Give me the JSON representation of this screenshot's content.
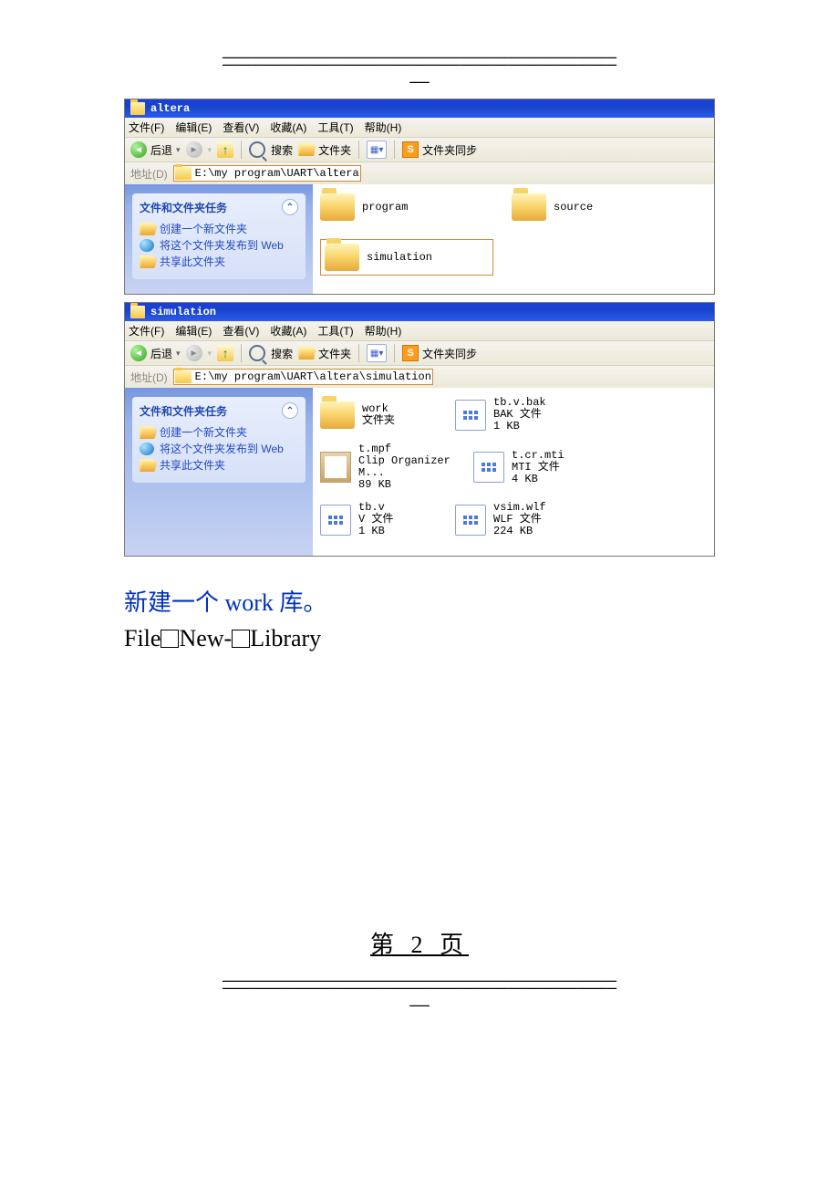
{
  "separator": {
    "line": "————————————————————————————————————————",
    "center": "——"
  },
  "win1": {
    "title": "altera",
    "address": "E:\\my program\\UART\\altera",
    "menu": {
      "file": "文件(F)",
      "edit": "编辑(E)",
      "view": "查看(V)",
      "fav": "收藏(A)",
      "tools": "工具(T)",
      "help": "帮助(H)"
    },
    "toolbar": {
      "back": "后退",
      "search": "搜索",
      "folders": "文件夹",
      "sync": "文件夹同步"
    },
    "address_label": "地址(D)",
    "sidebar": {
      "heading": "文件和文件夹任务",
      "tasks": [
        "创建一个新文件夹",
        "将这个文件夹发布到 Web",
        "共享此文件夹"
      ]
    },
    "items": [
      {
        "name": "program"
      },
      {
        "name": "source"
      },
      {
        "name": "simulation"
      }
    ]
  },
  "win2": {
    "title": "simulation",
    "address": "E:\\my program\\UART\\altera\\simulation",
    "menu": {
      "file": "文件(F)",
      "edit": "编辑(E)",
      "view": "查看(V)",
      "fav": "收藏(A)",
      "tools": "工具(T)",
      "help": "帮助(H)"
    },
    "toolbar": {
      "back": "后退",
      "search": "搜索",
      "folders": "文件夹",
      "sync": "文件夹同步"
    },
    "address_label": "地址(D)",
    "sidebar": {
      "heading": "文件和文件夹任务",
      "tasks": [
        "创建一个新文件夹",
        "将这个文件夹发布到 Web",
        "共享此文件夹"
      ]
    },
    "items_row1": [
      {
        "name": "work",
        "sub": "文件夹",
        "type": "folder"
      },
      {
        "name": "tb.v.bak",
        "sub1": "BAK 文件",
        "sub2": "1 KB",
        "type": "file"
      },
      {
        "name": "t.mpf",
        "sub1": "Clip Organizer M...",
        "sub2": "89 KB",
        "type": "img"
      }
    ],
    "items_row2": [
      {
        "name": "t.cr.mti",
        "sub1": "MTI 文件",
        "sub2": "4 KB",
        "type": "file"
      },
      {
        "name": "tb.v",
        "sub1": "V 文件",
        "sub2": "1 KB",
        "type": "file"
      },
      {
        "name": "vsim.wlf",
        "sub1": "WLF 文件",
        "sub2": "224 KB",
        "type": "file"
      }
    ]
  },
  "caption_blue": "新建一个 work 库。",
  "caption_black_1": "File",
  "caption_black_2": "New-",
  "caption_black_3": "Library",
  "page_number": "第 2 页"
}
